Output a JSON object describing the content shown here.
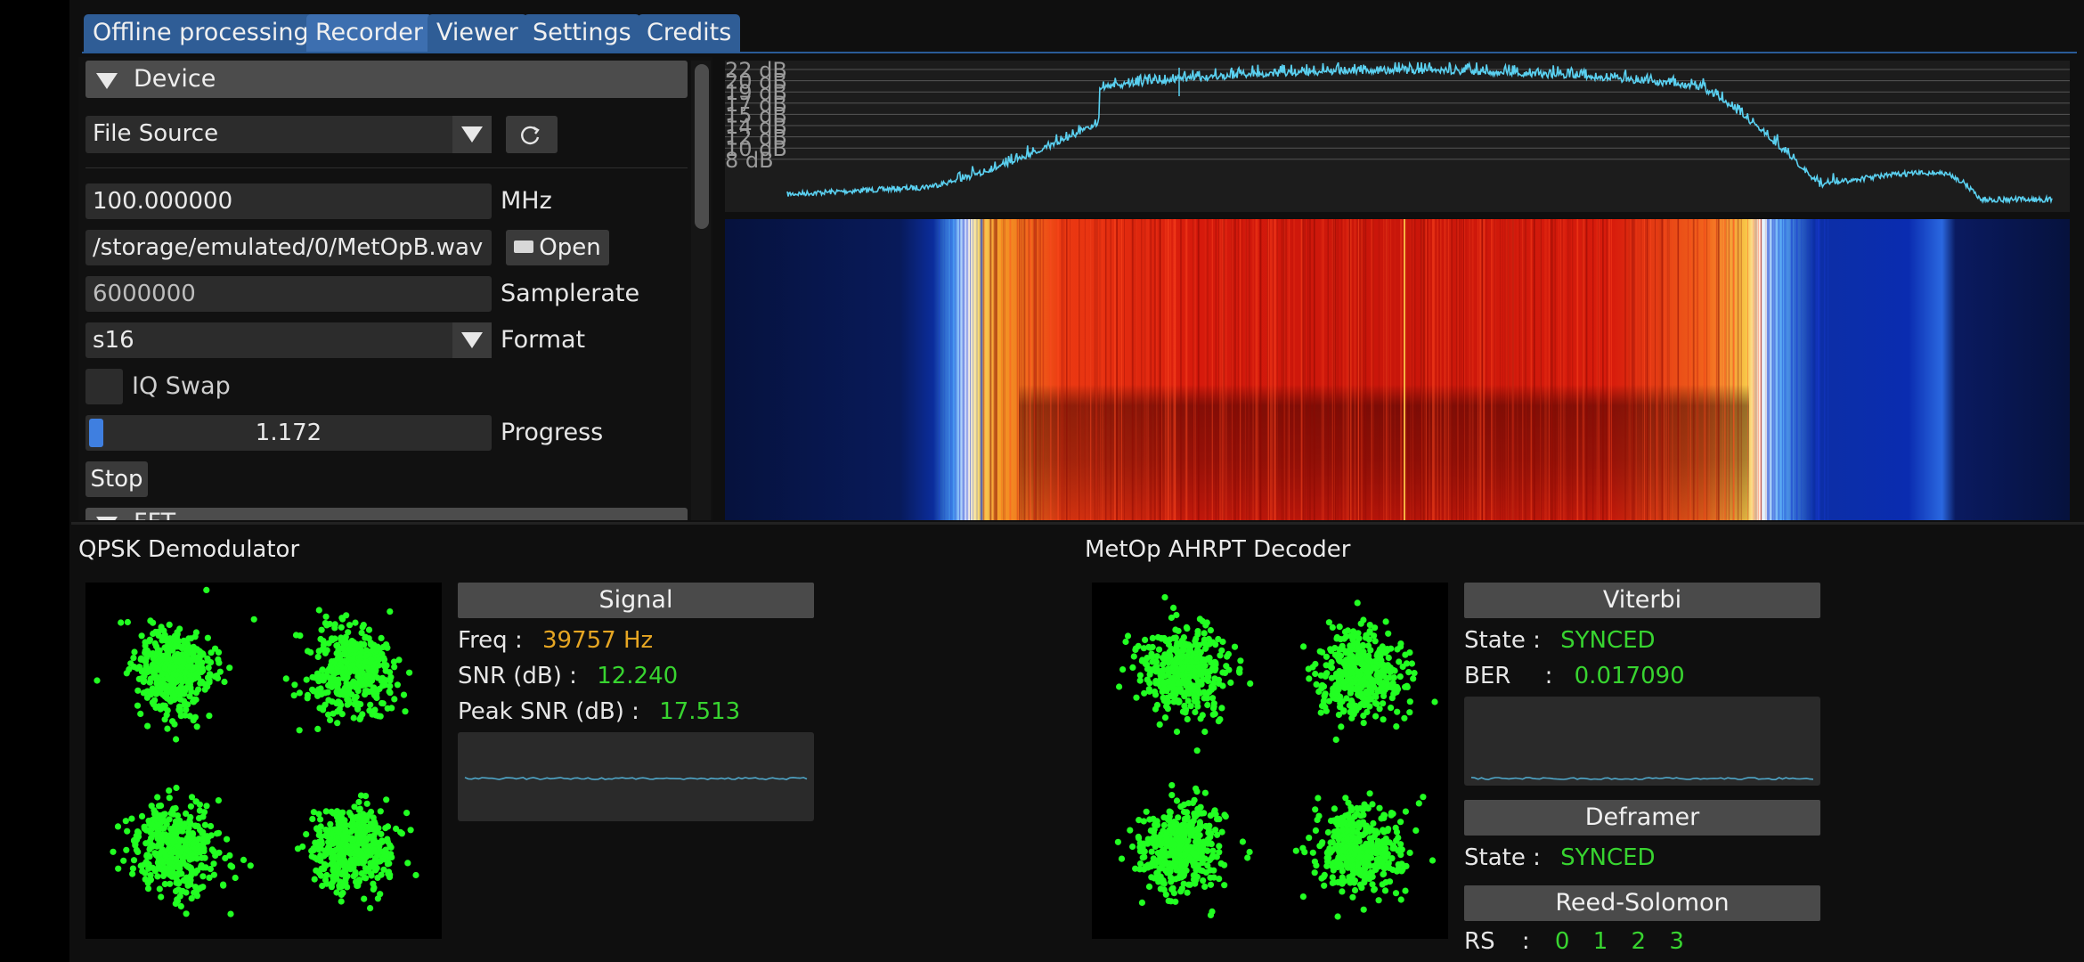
{
  "tabs": [
    "Offline processing",
    "Recorder",
    "Viewer",
    "Settings",
    "Credits"
  ],
  "active_tab": 1,
  "device": {
    "header": "Device",
    "source": "File Source",
    "frequency": "100.000000",
    "frequency_unit": "MHz",
    "file_path": "/storage/emulated/0/MetOpB.wav",
    "open_label": "Open",
    "samplerate": "6000000",
    "samplerate_label": "Samplerate",
    "format": "s16",
    "format_label": "Format",
    "iq_swap_label": "IQ Swap",
    "iq_swap_checked": false,
    "progress_value": "1.172",
    "progress_fraction": 0.02,
    "progress_label": "Progress",
    "stop_label": "Stop",
    "next_header": "FFT"
  },
  "spectrum": {
    "db_ticks": [
      "22 dB",
      "20 dB",
      "19 dB",
      "17 dB",
      "15 dB",
      "14 dB",
      "12 dB",
      "10 dB",
      "8 dB"
    ],
    "trace_color": "#5ad0f0"
  },
  "qpsk": {
    "title": "QPSK Demodulator",
    "signal_header": "Signal",
    "freq_label": "Freq :",
    "freq_value": "39757 Hz",
    "snr_label": "SNR (dB) :",
    "snr_value": "12.240",
    "peak_label": "Peak SNR (dB) :",
    "peak_value": "17.513"
  },
  "decoder": {
    "title": "MetOp AHRPT Decoder",
    "viterbi_header": "Viterbi",
    "state_label": "State :",
    "viterbi_state": "SYNCED",
    "ber_label": "BER",
    "ber_colon": ":",
    "ber_value": "0.017090",
    "deframer_header": "Deframer",
    "deframer_state_label": "State :",
    "deframer_state": "SYNCED",
    "rs_header": "Reed-Solomon",
    "rs_label": "RS",
    "rs_colon": ":",
    "rs_values": [
      "0",
      "1",
      "2",
      "3"
    ]
  },
  "colors": {
    "accent": "#3d6fb0",
    "synced": "#38d430",
    "freq": "#e6a623",
    "constellation": "#22ff22"
  }
}
